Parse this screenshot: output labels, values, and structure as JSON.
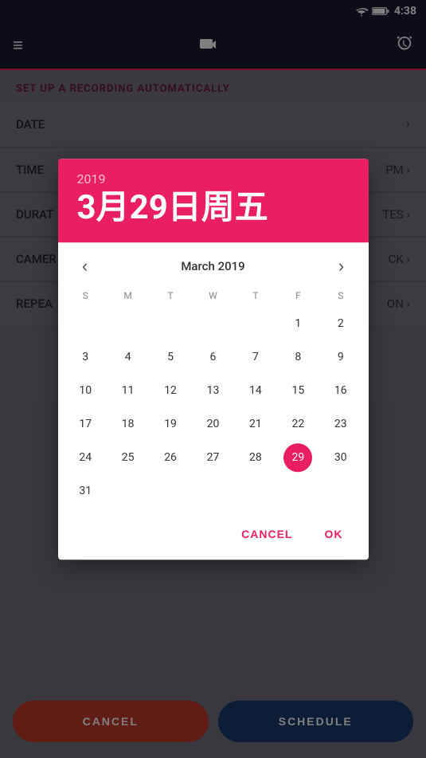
{
  "statusBar": {
    "time": "4:38"
  },
  "topNav": {
    "menuIcon": "≡",
    "videoIcon": "📹",
    "alarmIcon": "⏰"
  },
  "bgContent": {
    "setupLabel": "SET UP A RECORDING AUTOMATICALLY",
    "rows": [
      {
        "label": "DATE",
        "value": "",
        "arrow": "›"
      },
      {
        "label": "TIME",
        "value": "PM",
        "arrow": "›"
      },
      {
        "label": "DURAT",
        "value": "TES",
        "arrow": "›"
      },
      {
        "label": "CAMER",
        "value": "CK",
        "arrow": "›"
      },
      {
        "label": "REPEA",
        "value": "ON",
        "arrow": "›"
      }
    ]
  },
  "dialog": {
    "year": "2019",
    "dateDisplay": "3月29日周五",
    "calendarTitle": "March 2019",
    "daysOfWeek": [
      "S",
      "M",
      "T",
      "W",
      "T",
      "F",
      "S"
    ],
    "weeks": [
      [
        "",
        "",
        "",
        "",
        "",
        "1",
        "2"
      ],
      [
        "3",
        "4",
        "5",
        "6",
        "7",
        "8",
        "9"
      ],
      [
        "10",
        "11",
        "12",
        "13",
        "14",
        "15",
        "16"
      ],
      [
        "17",
        "18",
        "19",
        "20",
        "21",
        "22",
        "23"
      ],
      [
        "24",
        "25",
        "26",
        "27",
        "28",
        "29",
        "30"
      ],
      [
        "31",
        "",
        "",
        "",
        "",
        "",
        ""
      ]
    ],
    "selectedDay": "29",
    "cancelLabel": "CANCEL",
    "okLabel": "OK"
  },
  "bottomButtons": {
    "cancelLabel": "CANCEL",
    "scheduleLabel": "SCHEDULE"
  },
  "colors": {
    "accent": "#e91e63",
    "navBg": "#1a1a2e",
    "scheduleBg": "#1a3a6b",
    "cancelBg": "#c0392b"
  }
}
